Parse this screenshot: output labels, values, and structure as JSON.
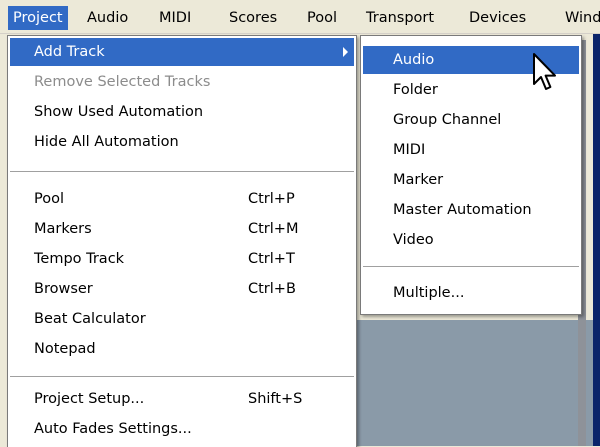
{
  "menubar": {
    "items": [
      {
        "label": "Project"
      },
      {
        "label": "Audio"
      },
      {
        "label": "MIDI"
      },
      {
        "label": "Scores"
      },
      {
        "label": "Pool"
      },
      {
        "label": "Transport"
      },
      {
        "label": "Devices"
      },
      {
        "label": "Wind"
      }
    ]
  },
  "project_menu": {
    "items": [
      {
        "label": "Add Track",
        "shortcut": ""
      },
      {
        "label": "Remove Selected Tracks",
        "shortcut": ""
      },
      {
        "label": "Show Used Automation",
        "shortcut": ""
      },
      {
        "label": "Hide All Automation",
        "shortcut": ""
      },
      {
        "label": "Pool",
        "shortcut": "Ctrl+P"
      },
      {
        "label": "Markers",
        "shortcut": "Ctrl+M"
      },
      {
        "label": "Tempo Track",
        "shortcut": "Ctrl+T"
      },
      {
        "label": "Browser",
        "shortcut": "Ctrl+B"
      },
      {
        "label": "Beat Calculator",
        "shortcut": ""
      },
      {
        "label": "Notepad",
        "shortcut": ""
      },
      {
        "label": "Project Setup...",
        "shortcut": "Shift+S"
      },
      {
        "label": "Auto Fades Settings...",
        "shortcut": ""
      }
    ]
  },
  "add_track_submenu": {
    "items": [
      {
        "label": "Audio"
      },
      {
        "label": "Folder"
      },
      {
        "label": "Group Channel"
      },
      {
        "label": "MIDI"
      },
      {
        "label": "Marker"
      },
      {
        "label": "Master Automation"
      },
      {
        "label": "Video"
      },
      {
        "label": "Multiple..."
      }
    ]
  },
  "colors": {
    "highlight": "#316ac5",
    "menubar_bg": "#ece9d8",
    "disabled_text": "#8c8c8c"
  }
}
